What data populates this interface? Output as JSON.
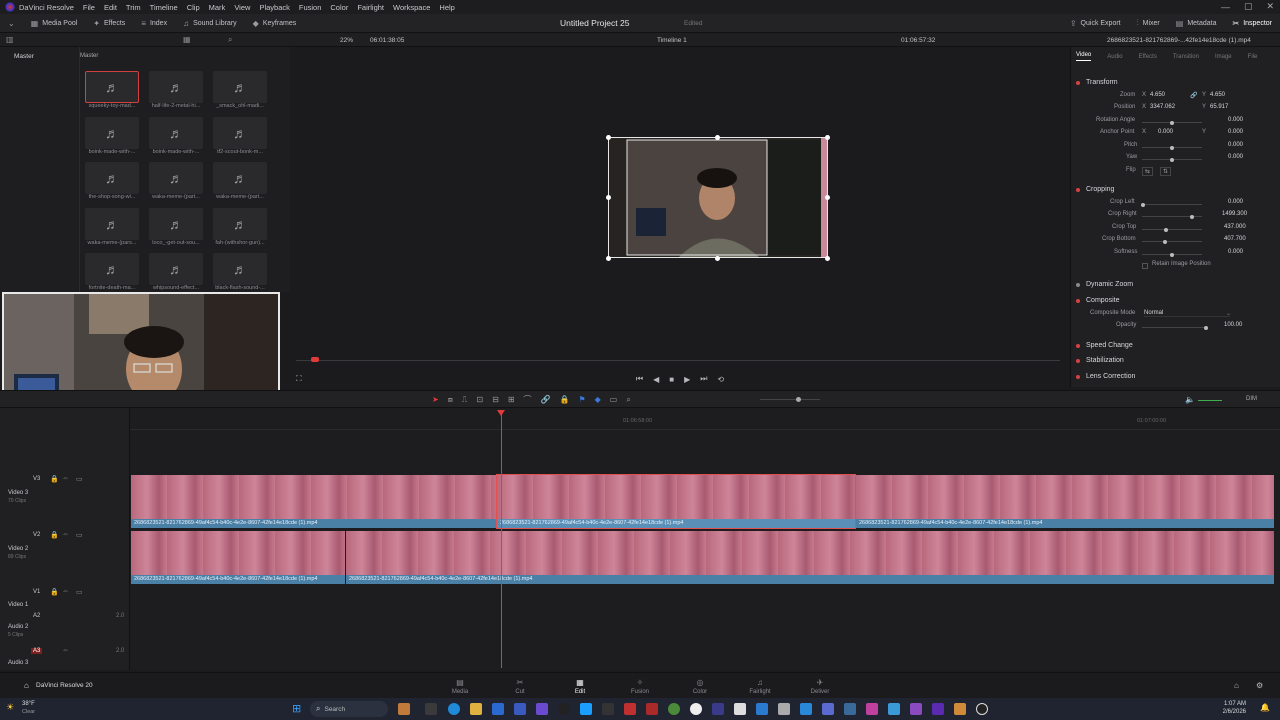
{
  "menubar": {
    "app_name": "DaVinci Resolve",
    "items": [
      "File",
      "Edit",
      "Trim",
      "Timeline",
      "Clip",
      "Mark",
      "View",
      "Playback",
      "Fusion",
      "Color",
      "Fairlight",
      "Workspace",
      "Help"
    ],
    "controls": [
      "—",
      "▢",
      "✕"
    ]
  },
  "toolbar": {
    "left": [
      {
        "icon": "media-pool-icon",
        "label": "Media Pool"
      },
      {
        "icon": "effects-icon",
        "label": "Effects"
      },
      {
        "icon": "index-icon",
        "label": "Index"
      },
      {
        "icon": "sound-library-icon",
        "label": "Sound Library"
      },
      {
        "icon": "keyframes-icon",
        "label": "Keyframes"
      }
    ],
    "project_title": "Untitled Project 25",
    "project_state": "Edited",
    "right": [
      {
        "icon": "quick-export-icon",
        "label": "Quick Export"
      },
      {
        "icon": "mixer-icon",
        "label": "Mixer"
      },
      {
        "icon": "metadata-icon",
        "label": "Metadata"
      },
      {
        "icon": "inspector-icon",
        "label": "Inspector"
      }
    ]
  },
  "subbar": {
    "zoom": "22%",
    "source_timecode": "06:01:38:05",
    "timeline_name": "Timeline 1",
    "timecode": "01:06:57:32",
    "clip_name": "2686823521-821762869-...42fe14e18cde (1).mp4"
  },
  "media_pool": {
    "bin": "Master",
    "bin_header": "Master",
    "clips": [
      "squeeky-toy-mad...",
      "half-life-2-metal-hi...",
      "_smack_ohl-madi...",
      "boink-made-with-...",
      "boink-made-with-...",
      "tf2-scout-bonk-m...",
      "the-shop-song-wi...",
      "waka-meme-(part...",
      "waka-meme-(part...",
      "waka-meme-(pars...",
      "loco_-get-out-sou...",
      "fah-(withshor-gun)...",
      "fortnite-death-ma...",
      "whipsound-effect...",
      "black-flash-sound-..."
    ]
  },
  "inspector": {
    "tabs": [
      "Video",
      "Audio",
      "Effects",
      "Transition",
      "Image",
      "File"
    ],
    "transform": {
      "title": "Transform",
      "zoom_label": "Zoom",
      "zoom_x": "4.650",
      "zoom_y": "4.650",
      "position_label": "Position",
      "position_x": "3347.062",
      "position_y": "65.917",
      "rotation_label": "Rotation Angle",
      "rotation": "0.000",
      "anchor_label": "Anchor Point",
      "anchor_x": "0.000",
      "anchor_y": "0.000",
      "pitch_label": "Pitch",
      "pitch": "0.000",
      "yaw_label": "Yaw",
      "yaw": "0.000",
      "flip_label": "Flip",
      "x_label": "X",
      "y_label": "Y"
    },
    "cropping": {
      "title": "Cropping",
      "left_label": "Crop Left",
      "left": "0.000",
      "right_label": "Crop Right",
      "right": "1499.300",
      "top_label": "Crop Top",
      "top": "437.000",
      "bottom_label": "Crop Bottom",
      "bottom": "407.700",
      "softness_label": "Softness",
      "softness": "0.000",
      "retain_label": "Retain Image Position"
    },
    "dynamic_zoom": "Dynamic Zoom",
    "composite": {
      "title": "Composite",
      "mode_label": "Composite Mode",
      "mode": "Normal",
      "opacity_label": "Opacity",
      "opacity": "100.00"
    },
    "speed_change": "Speed Change",
    "stabilization": "Stabilization",
    "lens_correction": "Lens Correction"
  },
  "timeline": {
    "ruler": [
      "01:06:58:00",
      "01:07:00:00"
    ],
    "dim_label": "DIM",
    "tracks": [
      {
        "id": "V3",
        "name": "Video 3",
        "sub": "70 Clips"
      },
      {
        "id": "V2",
        "name": "Video 2",
        "sub": "89 Clips"
      },
      {
        "id": "V1",
        "name": "Video 1",
        "sub": ""
      },
      {
        "id": "A2",
        "name": "Audio 2",
        "sub": "5 Clips",
        "level": "2.0"
      },
      {
        "id": "A3",
        "name": "Audio 3",
        "sub": "",
        "level": "2.0"
      }
    ],
    "clips_v3": [
      "2686823521-821762869-49af4c54-b40c-4e2e-8607-42fe14e18cde (1).mp4",
      "2686823521-821762869-49af4c54-b40c-4e2e-8607-42fe14e18cde (1).mp4",
      "2686823521-821762869-49af4c54-b40c-4e2e-8607-42fe14e18cde (1).mp4"
    ],
    "clips_v2": [
      "2686823521-821762869-49af4c54-b40c-4e2e-8607-42fe14e18cde (1).mp4",
      "2686823521-821762869-49af4c54-b40c-4e2e-8607-42fe14e18cde (1).mp4"
    ]
  },
  "pages": {
    "app_label": "DaVinci Resolve 20",
    "tabs": [
      "Media",
      "Cut",
      "Edit",
      "Fusion",
      "Color",
      "Fairlight",
      "Deliver"
    ],
    "active": "Edit"
  },
  "taskbar": {
    "weather_temp": "38°F",
    "weather_desc": "Clear",
    "search_placeholder": "Search",
    "time": "1:07 AM",
    "date": "2/6/2026"
  },
  "colors": {
    "accent_red": "#e03a3a",
    "clip_pink": "#c06a82",
    "clip_bar_blue": "#4a7fa6"
  }
}
